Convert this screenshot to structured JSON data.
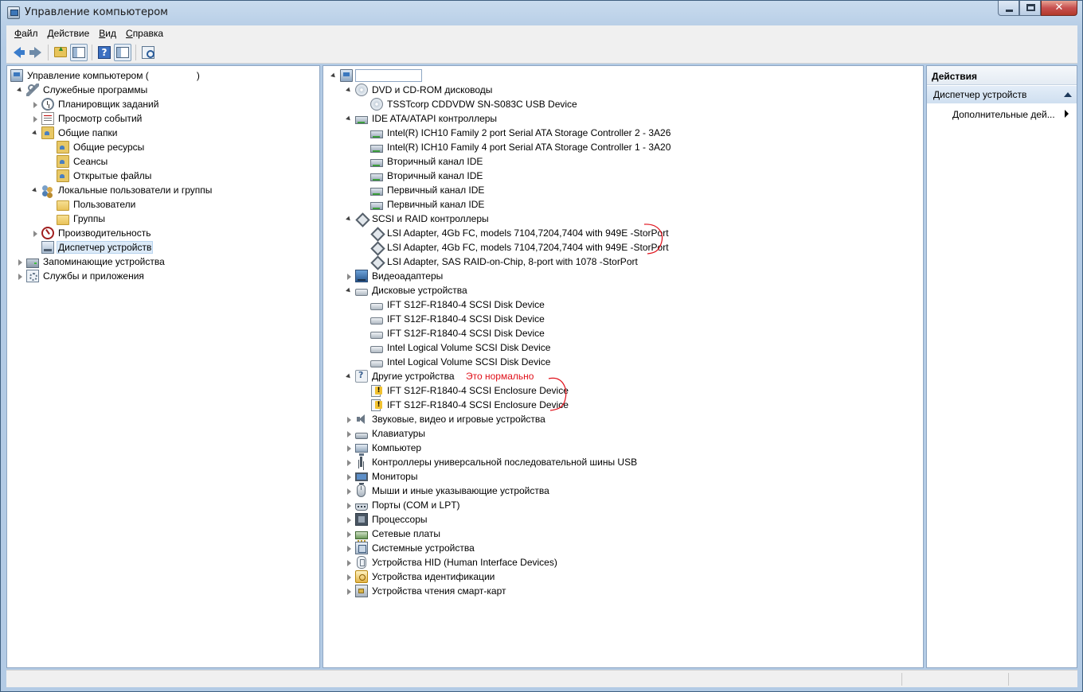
{
  "window": {
    "title": "Управление компьютером"
  },
  "menu": [
    {
      "accel": "Ф",
      "rest": "айл"
    },
    {
      "accel": "Д",
      "rest": "ействие"
    },
    {
      "accel": "В",
      "rest": "ид"
    },
    {
      "accel": "С",
      "rest": "правка"
    }
  ],
  "toolbar": {
    "icons": [
      "back-arrow-icon",
      "forward-arrow-icon",
      "folder-up-icon",
      "show-hide-tree-icon",
      "help-icon",
      "action-pane-icon",
      "scan-hardware-icon"
    ]
  },
  "left_tree": {
    "root": "Управление компьютером (",
    "root_suffix": ")",
    "items": [
      "Служебные программы",
      "Планировщик заданий",
      "Просмотр событий",
      "Общие папки",
      "Общие ресурсы",
      "Сеансы",
      "Открытые файлы",
      "Локальные пользователи и группы",
      "Пользователи",
      "Группы",
      "Производительность",
      "Диспетчер устройств",
      "Запоминающие устройства",
      "Службы и приложения"
    ]
  },
  "device_tree": {
    "categories": [
      {
        "name": "DVD и CD-ROM дисководы",
        "children": [
          "TSSTcorp CDDVDW SN-S083C USB Device"
        ]
      },
      {
        "name": "IDE ATA/ATAPI контроллеры",
        "children": [
          "Intel(R) ICH10 Family 2 port Serial ATA Storage Controller 2 - 3A26",
          "Intel(R) ICH10 Family 4 port Serial ATA Storage Controller 1 - 3A20",
          "Вторичный канал IDE",
          "Вторичный канал IDE",
          "Первичный канал IDE",
          "Первичный канал IDE"
        ]
      },
      {
        "name": "SCSI и RAID контроллеры",
        "children": [
          "LSI Adapter, 4Gb FC, models 7104,7204,7404 with 949E -StorPort",
          "LSI Adapter, 4Gb FC, models 7104,7204,7404 with 949E -StorPort",
          "LSI Adapter, SAS RAID-on-Chip, 8-port with 1078 -StorPort"
        ]
      },
      {
        "name": "Видеоадаптеры"
      },
      {
        "name": "Дисковые устройства",
        "children": [
          "IFT S12F-R1840-4 SCSI Disk Device",
          "IFT S12F-R1840-4 SCSI Disk Device",
          "IFT S12F-R1840-4 SCSI Disk Device",
          "Intel Logical Volume SCSI Disk Device",
          "Intel Logical Volume SCSI Disk Device"
        ]
      },
      {
        "name": "Другие устройства",
        "children": [
          "IFT S12F-R1840-4 SCSI Enclosure Device",
          "IFT S12F-R1840-4 SCSI Enclosure Device"
        ]
      },
      {
        "name": "Звуковые, видео и игровые устройства"
      },
      {
        "name": "Клавиатуры"
      },
      {
        "name": "Компьютер"
      },
      {
        "name": "Контроллеры универсальной последовательной шины USB"
      },
      {
        "name": "Мониторы"
      },
      {
        "name": "Мыши и иные указывающие устройства"
      },
      {
        "name": "Порты (COM и LPT)"
      },
      {
        "name": "Процессоры"
      },
      {
        "name": "Сетевые платы"
      },
      {
        "name": "Системные устройства"
      },
      {
        "name": "Устройства HID (Human Interface Devices)"
      },
      {
        "name": "Устройства идентификации"
      },
      {
        "name": "Устройства чтения смарт-карт"
      }
    ]
  },
  "annotation": {
    "text": "Это нормально",
    "color": "#e0101a"
  },
  "actions": {
    "header": "Действия",
    "section": "Диспетчер устройств",
    "more": "Дополнительные дей..."
  },
  "colors": {
    "selection": "#dceaf8",
    "frame": "#b3cbe5",
    "annotation": "#e0101a"
  }
}
